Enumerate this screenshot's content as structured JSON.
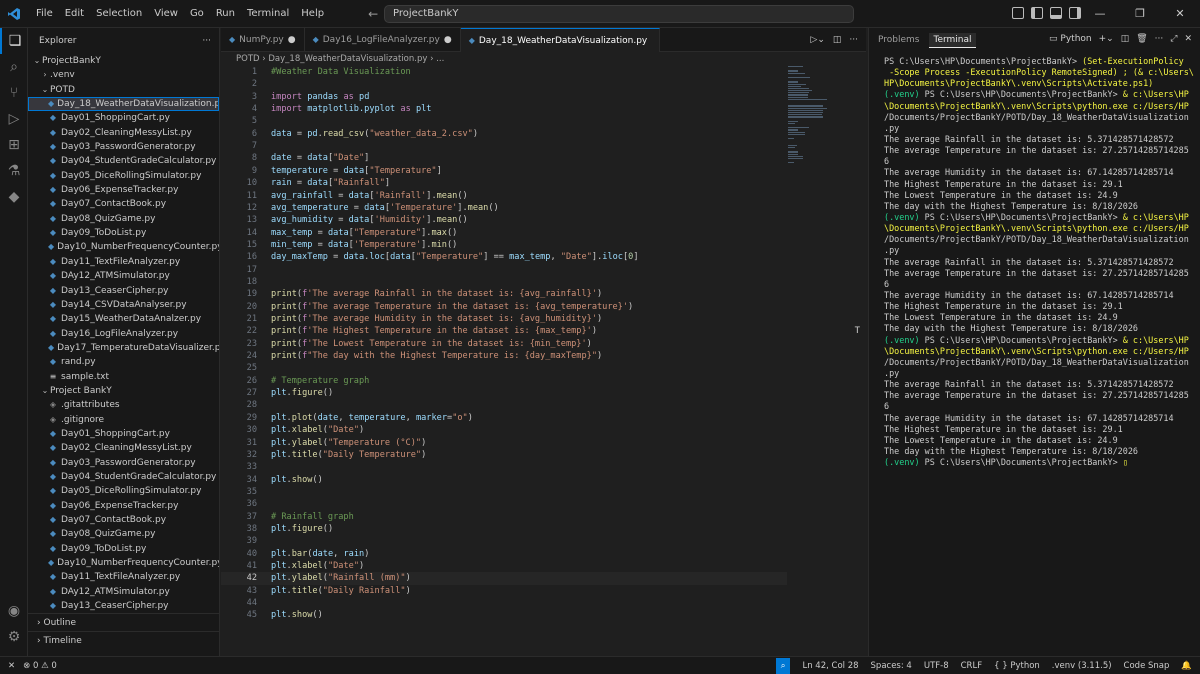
{
  "title_bar": {
    "menu": [
      "File",
      "Edit",
      "Selection",
      "View",
      "Go",
      "Run",
      "Terminal",
      "Help"
    ],
    "search": "ProjectBankY"
  },
  "explorer": {
    "header": "Explorer",
    "root": "ProjectBankY",
    "items": [
      {
        "label": ".venv",
        "type": "folder-collapsed",
        "indent": 1
      },
      {
        "label": "POTD",
        "type": "folder-open",
        "indent": 1
      },
      {
        "label": "Day_18_WeatherDataVisualization.py",
        "type": "py",
        "indent": 2,
        "selected": true
      },
      {
        "label": "Day01_ShoppingCart.py",
        "type": "py",
        "indent": 2
      },
      {
        "label": "Day02_CleaningMessyList.py",
        "type": "py",
        "indent": 2
      },
      {
        "label": "Day03_PasswordGenerator.py",
        "type": "py",
        "indent": 2
      },
      {
        "label": "Day04_StudentGradeCalculator.py",
        "type": "py",
        "indent": 2
      },
      {
        "label": "Day05_DiceRollingSimulator.py",
        "type": "py",
        "indent": 2
      },
      {
        "label": "Day06_ExpenseTracker.py",
        "type": "py",
        "indent": 2
      },
      {
        "label": "Day07_ContactBook.py",
        "type": "py",
        "indent": 2
      },
      {
        "label": "Day08_QuizGame.py",
        "type": "py",
        "indent": 2
      },
      {
        "label": "Day09_ToDoList.py",
        "type": "py",
        "indent": 2
      },
      {
        "label": "Day10_NumberFrequencyCounter.py",
        "type": "py",
        "indent": 2
      },
      {
        "label": "Day11_TextFileAnalyzer.py",
        "type": "py",
        "indent": 2
      },
      {
        "label": "DAy12_ATMSimulator.py",
        "type": "py",
        "indent": 2
      },
      {
        "label": "Day13_CeaserCipher.py",
        "type": "py",
        "indent": 2
      },
      {
        "label": "Day14_CSVDataAnalyser.py",
        "type": "py",
        "indent": 2
      },
      {
        "label": "Day15_WeatherDataAnalzer.py",
        "type": "py",
        "indent": 2
      },
      {
        "label": "Day16_LogFileAnalyzer.py",
        "type": "py",
        "indent": 2
      },
      {
        "label": "Day17_TemperatureDataVisualizer.py",
        "type": "py",
        "indent": 2
      },
      {
        "label": "rand.py",
        "type": "py",
        "indent": 2
      },
      {
        "label": "sample.txt",
        "type": "txt",
        "indent": 2
      },
      {
        "label": "Project BankY",
        "type": "folder-open",
        "indent": 1
      },
      {
        "label": ".gitattributes",
        "type": "git",
        "indent": 2
      },
      {
        "label": ".gitignore",
        "type": "git",
        "indent": 2
      },
      {
        "label": "Day01_ShoppingCart.py",
        "type": "py",
        "indent": 2
      },
      {
        "label": "Day02_CleaningMessyList.py",
        "type": "py",
        "indent": 2
      },
      {
        "label": "Day03_PasswordGenerator.py",
        "type": "py",
        "indent": 2
      },
      {
        "label": "Day04_StudentGradeCalculator.py",
        "type": "py",
        "indent": 2
      },
      {
        "label": "Day05_DiceRollingSimulator.py",
        "type": "py",
        "indent": 2
      },
      {
        "label": "Day06_ExpenseTracker.py",
        "type": "py",
        "indent": 2
      },
      {
        "label": "Day07_ContactBook.py",
        "type": "py",
        "indent": 2
      },
      {
        "label": "Day08_QuizGame.py",
        "type": "py",
        "indent": 2
      },
      {
        "label": "Day09_ToDoList.py",
        "type": "py",
        "indent": 2
      },
      {
        "label": "Day10_NumberFrequencyCounter.py",
        "type": "py",
        "indent": 2
      },
      {
        "label": "Day11_TextFileAnalyzer.py",
        "type": "py",
        "indent": 2
      },
      {
        "label": "DAy12_ATMSimulator.py",
        "type": "py",
        "indent": 2
      },
      {
        "label": "Day13_CeaserCipher.py",
        "type": "py",
        "indent": 2
      }
    ],
    "outline": "Outline",
    "timeline": "Timeline"
  },
  "tabs": [
    {
      "label": "NumPy.py",
      "modified": true,
      "active": false
    },
    {
      "label": "Day16_LogFileAnalyzer.py",
      "modified": true,
      "active": false
    },
    {
      "label": "Day_18_WeatherDataVisualization.py",
      "modified": false,
      "active": true
    }
  ],
  "breadcrumb": [
    "POTD",
    "Day_18_WeatherDataVisualization.py",
    "..."
  ],
  "code": [
    {
      "n": 1,
      "html": "<span class='cm'>#Weather Data Visualization</span>"
    },
    {
      "n": 2,
      "html": ""
    },
    {
      "n": 3,
      "html": "<span class='kw'>import</span> <span class='var'>pandas</span> <span class='kw'>as</span> <span class='var'>pd</span>"
    },
    {
      "n": 4,
      "html": "<span class='kw'>import</span> <span class='var'>matplotlib.pyplot</span> <span class='kw'>as</span> <span class='var'>plt</span>"
    },
    {
      "n": 5,
      "html": ""
    },
    {
      "n": 6,
      "html": "<span class='var'>data</span> = <span class='var'>pd</span>.<span class='fn'>read_csv</span>(<span class='str'>\"weather_data_2.csv\"</span>)"
    },
    {
      "n": 7,
      "html": ""
    },
    {
      "n": 8,
      "html": "<span class='var'>date</span> = <span class='var'>data</span>[<span class='str'>\"Date\"</span>]"
    },
    {
      "n": 9,
      "html": "<span class='var'>temperature</span> = <span class='var'>data</span>[<span class='str'>\"Temperature\"</span>]"
    },
    {
      "n": 10,
      "html": "<span class='var'>rain</span> = <span class='var'>data</span>[<span class='str'>\"Rainfall\"</span>]"
    },
    {
      "n": 11,
      "html": "<span class='var'>avg_rainfall</span> = <span class='var'>data</span>[<span class='str'>'Rainfall'</span>].<span class='fn'>mean</span>()"
    },
    {
      "n": 12,
      "html": "<span class='var'>avg_temperature</span> = <span class='var'>data</span>[<span class='str'>'Temperature'</span>].<span class='fn'>mean</span>()"
    },
    {
      "n": 13,
      "html": "<span class='var'>avg_humidity</span> = <span class='var'>data</span>[<span class='str'>'Humidity'</span>].<span class='fn'>mean</span>()"
    },
    {
      "n": 14,
      "html": "<span class='var'>max_temp</span> = <span class='var'>data</span>[<span class='str'>\"Temperature\"</span>].<span class='fn'>max</span>()"
    },
    {
      "n": 15,
      "html": "<span class='var'>min_temp</span> = <span class='var'>data</span>[<span class='str'>'Temperature'</span>].<span class='fn'>min</span>()"
    },
    {
      "n": 16,
      "html": "<span class='var'>day_maxTemp</span> = <span class='var'>data</span>.<span class='var'>loc</span>[<span class='var'>data</span>[<span class='str'>\"Temperature\"</span>] == <span class='var'>max_temp</span>, <span class='str'>\"Date\"</span>].<span class='var'>iloc</span>[<span class='num'>0</span>]"
    },
    {
      "n": 17,
      "html": ""
    },
    {
      "n": 18,
      "html": ""
    },
    {
      "n": 19,
      "html": "<span class='fn'>print</span>(<span class='kw'>f</span><span class='str'>'The average Rainfall in the dataset is: {avg_rainfall}'</span>)"
    },
    {
      "n": 20,
      "html": "<span class='fn'>print</span>(<span class='kw'>f</span><span class='str'>'The average Temperature in the dataset is: {avg_temperature}'</span>)"
    },
    {
      "n": 21,
      "html": "<span class='fn'>print</span>(<span class='kw'>f</span><span class='str'>'The average Humidity in the dataset is: {avg_humidity}'</span>)"
    },
    {
      "n": 22,
      "html": "<span class='fn'>print</span>(<span class='kw'>f</span><span class='str'>'The Highest Temperature in the dataset is: {max_temp}'</span>)"
    },
    {
      "n": 23,
      "html": "<span class='fn'>print</span>(<span class='kw'>f</span><span class='str'>'The Lowest Temperature in the dataset is: {min_temp}'</span>)"
    },
    {
      "n": 24,
      "html": "<span class='fn'>print</span>(<span class='kw'>f</span><span class='str'>\"The day with the Highest Temperature is: {day_maxTemp}\"</span>)"
    },
    {
      "n": 25,
      "html": ""
    },
    {
      "n": 26,
      "html": "<span class='cm'># Temperature graph</span>"
    },
    {
      "n": 27,
      "html": "<span class='var'>plt</span>.<span class='fn'>figure</span>()"
    },
    {
      "n": 28,
      "html": ""
    },
    {
      "n": 29,
      "html": "<span class='var'>plt</span>.<span class='fn'>plot</span>(<span class='var'>date</span>, <span class='var'>temperature</span>, <span class='var'>marker</span>=<span class='str'>\"o\"</span>)"
    },
    {
      "n": 30,
      "html": "<span class='var'>plt</span>.<span class='fn'>xlabel</span>(<span class='str'>\"Date\"</span>)"
    },
    {
      "n": 31,
      "html": "<span class='var'>plt</span>.<span class='fn'>ylabel</span>(<span class='str'>\"Temperature (°C)\"</span>)"
    },
    {
      "n": 32,
      "html": "<span class='var'>plt</span>.<span class='fn'>title</span>(<span class='str'>\"Daily Temperature\"</span>)"
    },
    {
      "n": 33,
      "html": ""
    },
    {
      "n": 34,
      "html": "<span class='var'>plt</span>.<span class='fn'>show</span>()"
    },
    {
      "n": 35,
      "html": ""
    },
    {
      "n": 36,
      "html": ""
    },
    {
      "n": 37,
      "html": "<span class='cm'># Rainfall graph</span>"
    },
    {
      "n": 38,
      "html": "<span class='var'>plt</span>.<span class='fn'>figure</span>()"
    },
    {
      "n": 39,
      "html": ""
    },
    {
      "n": 40,
      "html": "<span class='var'>plt</span>.<span class='fn'>bar</span>(<span class='var'>date</span>, <span class='var'>rain</span>)"
    },
    {
      "n": 41,
      "html": "<span class='var'>plt</span>.<span class='fn'>xlabel</span>(<span class='str'>\"Date\"</span>)"
    },
    {
      "n": 42,
      "html": "<span class='var'>plt</span>.<span class='fn'>ylabel</span>(<span class='str'>\"Rainfall (mm)\"</span>)",
      "current": true
    },
    {
      "n": 43,
      "html": "<span class='var'>plt</span>.<span class='fn'>title</span>(<span class='str'>\"Daily Rainfall\"</span>)"
    },
    {
      "n": 44,
      "html": ""
    },
    {
      "n": 45,
      "html": "<span class='var'>plt</span>.<span class='fn'>show</span>()"
    }
  ],
  "panel": {
    "tabs": [
      "Problems",
      "Terminal"
    ],
    "active_tab": "Terminal",
    "shell": "Python",
    "lines": [
      {
        "t": "PS C:\\Users\\HP\\Documents\\ProjectBankY> (Set-ExecutionPolicy",
        "c": "mix1"
      },
      {
        "t": " -Scope Process -ExecutionPolicy RemoteSigned) ; (& c:\\Users\\",
        "c": "y"
      },
      {
        "t": "HP\\Documents\\ProjectBankY\\.venv\\Scripts\\Activate.ps1)",
        "c": "y"
      },
      {
        "t": "(.venv) PS C:\\Users\\HP\\Documents\\ProjectBankY> & c:\\Users\\HP",
        "c": "venv"
      },
      {
        "t": "\\Documents\\ProjectBankY\\.venv\\Scripts\\python.exe c:/Users/HP",
        "c": "y"
      },
      {
        "t": "/Documents/ProjectBankY/POTD/Day_18_WeatherDataVisualization",
        "c": ""
      },
      {
        "t": ".py",
        "c": ""
      },
      {
        "t": "The average Rainfall in the dataset is: 5.371428571428572",
        "c": ""
      },
      {
        "t": "The average Temperature in the dataset is: 27.25714285714285",
        "c": ""
      },
      {
        "t": "6",
        "c": ""
      },
      {
        "t": "The average Humidity in the dataset is: 67.14285714285714",
        "c": ""
      },
      {
        "t": "The Highest Temperature in the dataset is: 29.1",
        "c": ""
      },
      {
        "t": "The Lowest Temperature in the dataset is: 24.9",
        "c": ""
      },
      {
        "t": "The day with the Highest Temperature is: 8/18/2026",
        "c": ""
      },
      {
        "t": "(.venv) PS C:\\Users\\HP\\Documents\\ProjectBankY> & c:\\Users\\HP",
        "c": "venv"
      },
      {
        "t": "\\Documents\\ProjectBankY\\.venv\\Scripts\\python.exe c:/Users/HP",
        "c": "y"
      },
      {
        "t": "/Documents/ProjectBankY/POTD/Day_18_WeatherDataVisualization",
        "c": ""
      },
      {
        "t": ".py",
        "c": ""
      },
      {
        "t": "The average Rainfall in the dataset is: 5.371428571428572",
        "c": ""
      },
      {
        "t": "The average Temperature in the dataset is: 27.25714285714285",
        "c": ""
      },
      {
        "t": "6",
        "c": ""
      },
      {
        "t": "The average Humidity in the dataset is: 67.14285714285714",
        "c": ""
      },
      {
        "t": "The Highest Temperature in the dataset is: 29.1",
        "c": ""
      },
      {
        "t": "The Lowest Temperature in the dataset is: 24.9",
        "c": ""
      },
      {
        "t": "The day with the Highest Temperature is: 8/18/2026",
        "c": ""
      },
      {
        "t": "(.venv) PS C:\\Users\\HP\\Documents\\ProjectBankY> & c:\\Users\\HP",
        "c": "venv"
      },
      {
        "t": "\\Documents\\ProjectBankY\\.venv\\Scripts\\python.exe c:/Users/HP",
        "c": "y"
      },
      {
        "t": "/Documents/ProjectBankY/POTD/Day_18_WeatherDataVisualization",
        "c": ""
      },
      {
        "t": ".py",
        "c": ""
      },
      {
        "t": "The average Rainfall in the dataset is: 5.371428571428572",
        "c": ""
      },
      {
        "t": "The average Temperature in the dataset is: 27.25714285714285",
        "c": ""
      },
      {
        "t": "6",
        "c": ""
      },
      {
        "t": "The average Humidity in the dataset is: 67.14285714285714",
        "c": ""
      },
      {
        "t": "The Highest Temperature in the dataset is: 29.1",
        "c": ""
      },
      {
        "t": "The Lowest Temperature in the dataset is: 24.9",
        "c": ""
      },
      {
        "t": "The day with the Highest Temperature is: 8/18/2026",
        "c": ""
      },
      {
        "t": "(.venv) PS C:\\Users\\HP\\Documents\\ProjectBankY> ▯",
        "c": "venv"
      }
    ]
  },
  "status": {
    "problems": "0",
    "warnings": "0",
    "position": "Ln 42, Col 28",
    "spaces": "Spaces: 4",
    "encoding": "UTF-8",
    "eol": "CRLF",
    "language": "Python",
    "interpreter": ".venv (3.11.5)",
    "codesnap": "Code Snap"
  },
  "colors": {
    "accent": "#0078d4",
    "venv_green": "#23d18b",
    "path_yellow": "#f5f543"
  }
}
